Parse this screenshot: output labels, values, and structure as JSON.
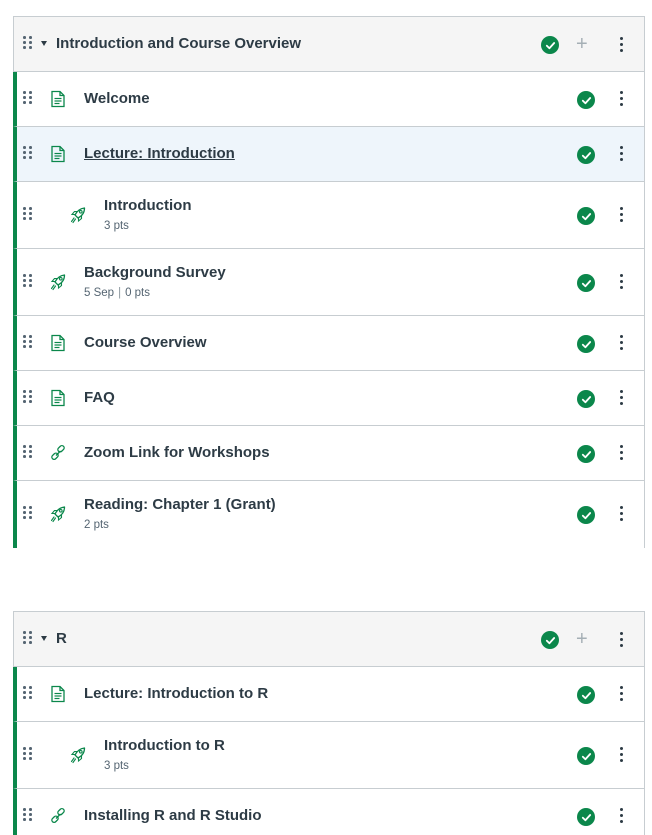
{
  "colors": {
    "published": "#0b874b",
    "accent": "#0b874b",
    "header_bg": "#f5f5f5",
    "highlight_bg": "#eef5fb"
  },
  "modules": [
    {
      "title": "Introduction and Course Overview",
      "status_icon": "published-check-icon",
      "items": [
        {
          "title": "Welcome",
          "icon": "page-icon"
        },
        {
          "title": "Lecture: Introduction",
          "icon": "page-icon"
        },
        {
          "title": "Introduction",
          "icon": "quiz-rocket-icon",
          "points": "3 pts"
        },
        {
          "title": "Background Survey",
          "icon": "quiz-rocket-icon",
          "date": "5 Sep",
          "divider": "|",
          "points": "0 pts"
        },
        {
          "title": "Course Overview",
          "icon": "page-icon"
        },
        {
          "title": "FAQ",
          "icon": "page-icon"
        },
        {
          "title": "Zoom Link for Workshops",
          "icon": "link-icon"
        },
        {
          "title": "Reading: Chapter 1 (Grant)",
          "icon": "quiz-rocket-icon",
          "points": "2 pts"
        }
      ]
    },
    {
      "title": "R",
      "status_icon": "published-check-icon",
      "items": [
        {
          "title": "Lecture: Introduction to R",
          "icon": "page-icon"
        },
        {
          "title": "Introduction to R",
          "icon": "quiz-rocket-icon",
          "points": "3 pts"
        },
        {
          "title": "Installing R and R Studio",
          "icon": "link-icon"
        }
      ]
    }
  ]
}
